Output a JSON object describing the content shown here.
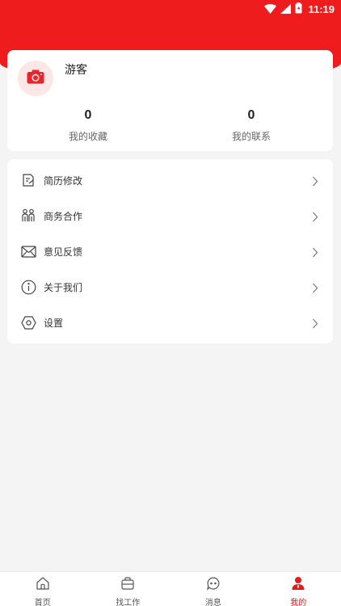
{
  "status_bar": {
    "time": "11:19"
  },
  "profile": {
    "username": "游客",
    "stats": [
      {
        "value": "0",
        "label": "我的收藏"
      },
      {
        "value": "0",
        "label": "我的联系"
      }
    ]
  },
  "menu": {
    "items": [
      {
        "label": "简历修改",
        "icon": "resume-edit-icon"
      },
      {
        "label": "商务合作",
        "icon": "business-cooperation-icon"
      },
      {
        "label": "意见反馈",
        "icon": "mail-icon"
      },
      {
        "label": "关于我们",
        "icon": "info-icon"
      },
      {
        "label": "设置",
        "icon": "settings-icon"
      }
    ]
  },
  "bottom_nav": {
    "items": [
      {
        "label": "首页",
        "icon": "home-icon"
      },
      {
        "label": "找工作",
        "icon": "briefcase-icon"
      },
      {
        "label": "消息",
        "icon": "chat-icon"
      },
      {
        "label": "我的",
        "icon": "user-icon",
        "active": true
      }
    ]
  },
  "colors": {
    "brand": "#ee1c1c",
    "background": "#f4f4f4"
  }
}
